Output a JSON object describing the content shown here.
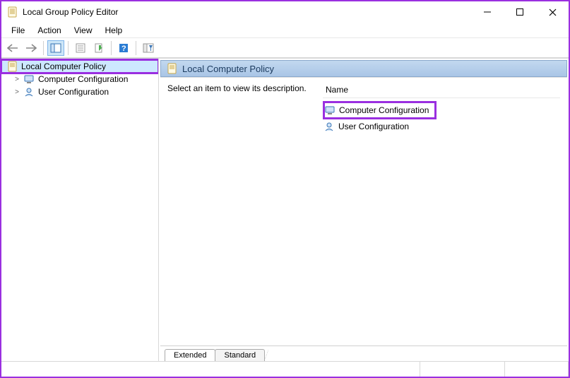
{
  "window": {
    "title": "Local Group Policy Editor"
  },
  "menu": {
    "items": [
      "File",
      "Action",
      "View",
      "Help"
    ]
  },
  "tree": {
    "root": {
      "label": "Local Computer Policy"
    },
    "children": [
      {
        "label": "Computer Configuration"
      },
      {
        "label": "User Configuration"
      }
    ]
  },
  "detail": {
    "header": "Local Computer Policy",
    "description": "Select an item to view its description.",
    "column_name": "Name",
    "list": [
      {
        "label": "Computer Configuration"
      },
      {
        "label": "User Configuration"
      }
    ]
  },
  "tabs": {
    "items": [
      "Extended",
      "Standard"
    ],
    "active": 0
  }
}
